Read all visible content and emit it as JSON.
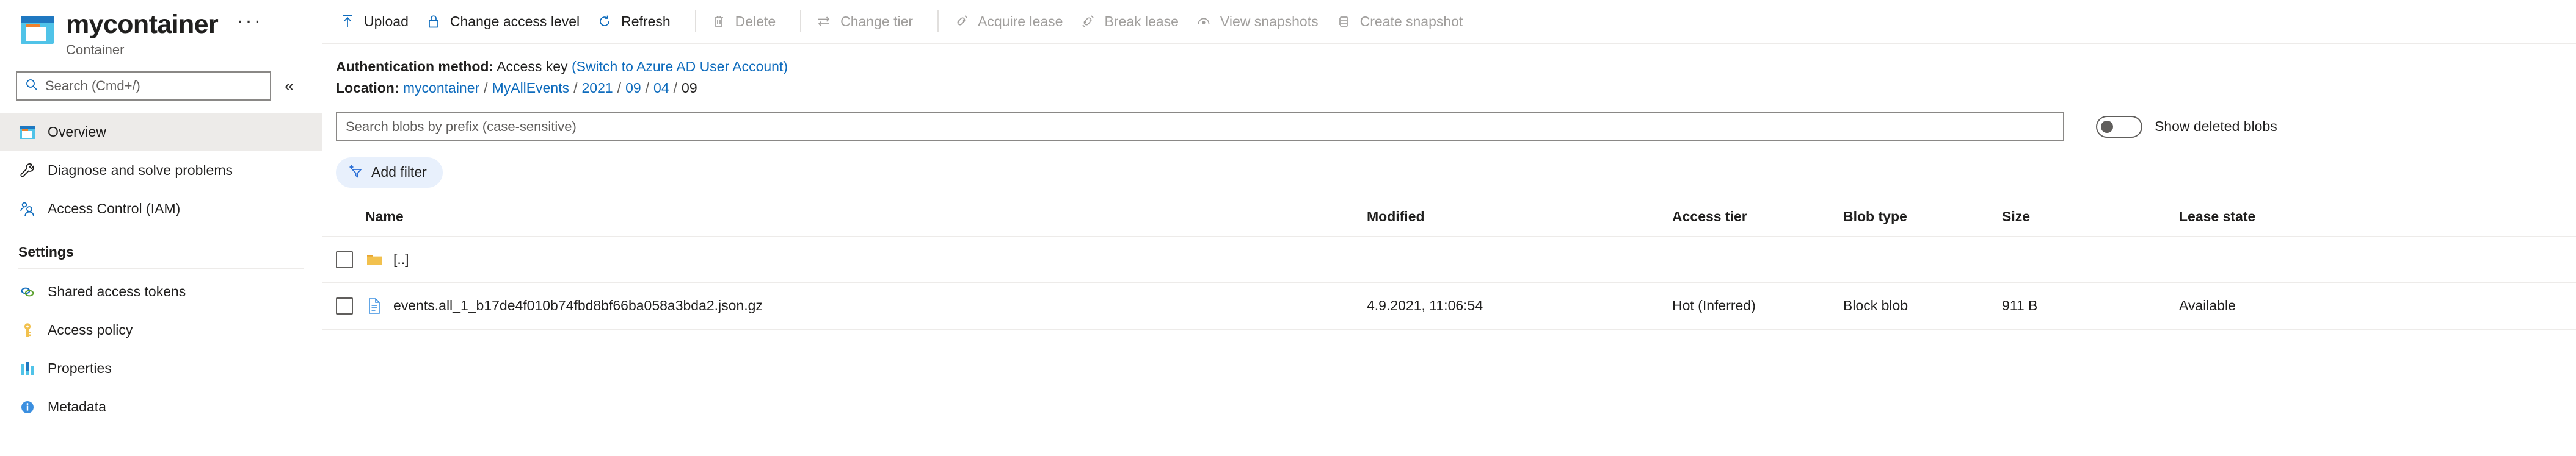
{
  "resource": {
    "title": "mycontainer",
    "subtitle": "Container",
    "icon": "container-icon",
    "more_label": "···"
  },
  "sidebar": {
    "search_placeholder": "Search (Cmd+/)",
    "collapse_label": "«",
    "items": [
      {
        "label": "Overview",
        "icon": "container-icon",
        "active": true
      },
      {
        "label": "Diagnose and solve problems",
        "icon": "wrench-icon",
        "active": false
      },
      {
        "label": "Access Control (IAM)",
        "icon": "people-icon",
        "active": false
      }
    ],
    "settings_title": "Settings",
    "settings_items": [
      {
        "label": "Shared access tokens",
        "icon": "links-icon"
      },
      {
        "label": "Access policy",
        "icon": "key-icon"
      },
      {
        "label": "Properties",
        "icon": "bars-icon"
      },
      {
        "label": "Metadata",
        "icon": "info-icon"
      }
    ]
  },
  "toolbar": {
    "buttons": [
      {
        "label": "Upload",
        "icon": "upload-icon",
        "disabled": false
      },
      {
        "label": "Change access level",
        "icon": "lock-icon",
        "disabled": false
      },
      {
        "label": "Refresh",
        "icon": "refresh-icon",
        "disabled": false
      },
      {
        "label": "Delete",
        "icon": "trash-icon",
        "disabled": true
      },
      {
        "label": "Change tier",
        "icon": "swap-icon",
        "disabled": true
      },
      {
        "label": "Acquire lease",
        "icon": "lease-icon",
        "disabled": true
      },
      {
        "label": "Break lease",
        "icon": "break-lease-icon",
        "disabled": true
      },
      {
        "label": "View snapshots",
        "icon": "snapshot-view-icon",
        "disabled": true
      },
      {
        "label": "Create snapshot",
        "icon": "snapshot-create-icon",
        "disabled": true
      }
    ]
  },
  "info": {
    "auth_label": "Authentication method:",
    "auth_value": "Access key",
    "auth_switch_link": "(Switch to Azure AD User Account)",
    "location_label": "Location:",
    "breadcrumb": [
      {
        "label": "mycontainer",
        "link": true
      },
      {
        "label": "MyAllEvents",
        "link": true
      },
      {
        "label": "2021",
        "link": true
      },
      {
        "label": "09",
        "link": true
      },
      {
        "label": "04",
        "link": true
      },
      {
        "label": "09",
        "link": false
      }
    ]
  },
  "filters": {
    "search_placeholder": "Search blobs by prefix (case-sensitive)",
    "search_value": "",
    "show_deleted_label": "Show deleted blobs",
    "show_deleted_on": false,
    "add_filter_label": "Add filter",
    "add_filter_icon": "add-filter-icon"
  },
  "table": {
    "columns": [
      "Name",
      "Modified",
      "Access tier",
      "Blob type",
      "Size",
      "Lease state"
    ],
    "rows": [
      {
        "icon": "folder-icon",
        "name": "[..]",
        "modified": "",
        "access_tier": "",
        "blob_type": "",
        "size": "",
        "lease_state": "",
        "checked": false
      },
      {
        "icon": "file-icon",
        "name": "events.all_1_b17de4f010b74fbd8bf66ba058a3bda2.json.gz",
        "modified": "4.9.2021, 11:06:54",
        "access_tier": "Hot (Inferred)",
        "blob_type": "Block blob",
        "size": "911 B",
        "lease_state": "Available",
        "checked": false
      }
    ]
  },
  "colors": {
    "accent": "#0f6cbd",
    "icon_blue": "#0078d4",
    "folder_yellow": "#f2c14e",
    "disabled": "#a19f9d",
    "pill_bg": "#e8f0fc"
  }
}
